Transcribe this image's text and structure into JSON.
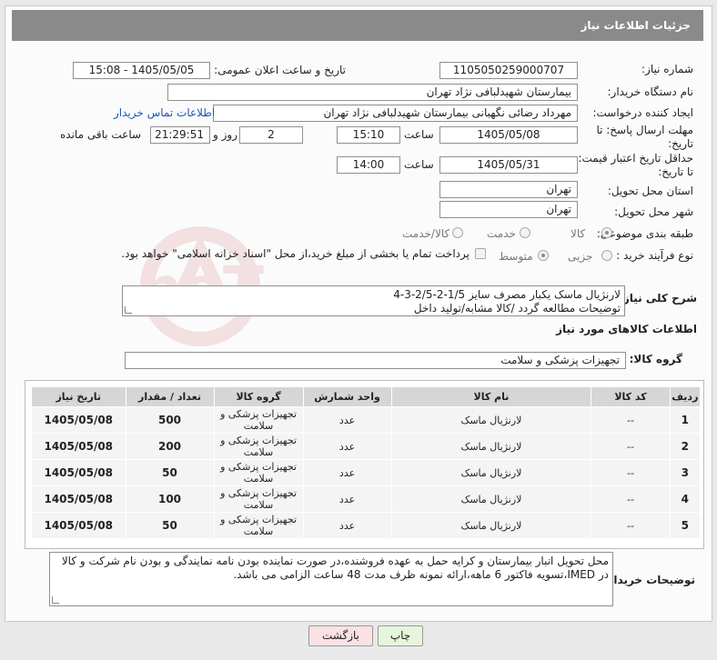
{
  "header": {
    "title": "جزئیات اطلاعات نیاز"
  },
  "fields": {
    "need_number_label": "شماره نیاز:",
    "need_number": "1105050259000707",
    "announce_label": "تاریخ و ساعت اعلان عمومی:",
    "announce_value": "1405/05/05 - 15:08",
    "buyer_label": "نام دستگاه خریدار:",
    "buyer_value": "بیمارستان شهیدلبافی نژاد تهران",
    "creator_label": "ایجاد کننده درخواست:",
    "creator_value": "مهرداد رضائی نگهبانی بیمارستان شهیدلبافی نژاد تهران",
    "contact_link": "اطلاعات تماس خریدار",
    "send_deadline_label_1": "مهلت ارسال پاسخ: تا",
    "send_deadline_label_2": "تاریخ:",
    "send_date": "1405/05/08",
    "time_label": "ساعت",
    "send_time": "15:10",
    "days_count": "2",
    "days_label": "روز و",
    "remaining_time": "21:29:51",
    "remaining_label": "ساعت باقی مانده",
    "validity_label_1": "حداقل تاریخ اعتبار قیمت:",
    "validity_label_2": "تا تاریخ:",
    "validity_date": "1405/05/31",
    "validity_time_label": "ساعت",
    "validity_time": "14:00",
    "province_label": "استان محل تحویل:",
    "province_value": "تهران",
    "city_label": "شهر محل تحویل:",
    "city_value": "تهران",
    "category_label": "طبقه بندی موضوعی:",
    "category_options": [
      "کالا",
      "خدمت",
      "کالا/خدمت"
    ],
    "category_selected": "کالا",
    "process_label": "نوع فرآیند خرید :",
    "process_options": [
      "جزیی",
      "متوسط"
    ],
    "process_selected": "متوسط",
    "payment_note": "پرداخت تمام یا بخشی از مبلغ خرید،از محل \"اسناد خزانه اسلامی\" خواهد بود.",
    "summary_label": "شرح کلی نیاز:",
    "summary_text_1": "لارنژیال ماسک یکبار مصرف سایز 1/5-2-2/5-3-4",
    "summary_text_2": "توضیحات مطالعه گردد /کالا مشابه/تولید داخل"
  },
  "goods_section": {
    "title": "اطلاعات کالاهای مورد نیاز",
    "group_label": "گروه کالا:",
    "group_value": "تجهیزات پزشکی و سلامت"
  },
  "table": {
    "headers": [
      "ردیف",
      "کد کالا",
      "نام کالا",
      "واحد شمارش",
      "گروه کالا",
      "تعداد / مقدار",
      "تاریخ نیاز"
    ],
    "rows": [
      {
        "num": "1",
        "code": "--",
        "name": "لارنژیال ماسک",
        "unit": "عدد",
        "group": "تجهیزات پزشکی و سلامت",
        "qty": "500",
        "date": "1405/05/08"
      },
      {
        "num": "2",
        "code": "--",
        "name": "لارنژیال ماسک",
        "unit": "عدد",
        "group": "تجهیزات پزشکی و سلامت",
        "qty": "200",
        "date": "1405/05/08"
      },
      {
        "num": "3",
        "code": "--",
        "name": "لارنژیال ماسک",
        "unit": "عدد",
        "group": "تجهیزات پزشکی و سلامت",
        "qty": "50",
        "date": "1405/05/08"
      },
      {
        "num": "4",
        "code": "--",
        "name": "لارنژیال ماسک",
        "unit": "عدد",
        "group": "تجهیزات پزشکی و سلامت",
        "qty": "100",
        "date": "1405/05/08"
      },
      {
        "num": "5",
        "code": "--",
        "name": "لارنژیال ماسک",
        "unit": "عدد",
        "group": "تجهیزات پزشکی و سلامت",
        "qty": "50",
        "date": "1405/05/08"
      }
    ]
  },
  "buyer_notes": {
    "label": "توضیحات خریدار:",
    "text": "محل تحویل انبار بیمارستان و کرایه حمل به عهده فروشنده،در صورت نماینده بودن نامه نمایندگی و بودن نام شرکت و کالا در IMED،تسویه فاکتور 6 ماهه،ارائه نمونه ظرف مدت 48 ساعت الزامی می باشد."
  },
  "buttons": {
    "print": "چاپ",
    "back": "بازگشت"
  },
  "watermark_text": "AriaTender.neT",
  "colors": {
    "header_bg": "#8a8a8a",
    "link": "#1a56b5",
    "print_btn": "#e5f6dc",
    "back_btn": "#fbe1e4"
  }
}
